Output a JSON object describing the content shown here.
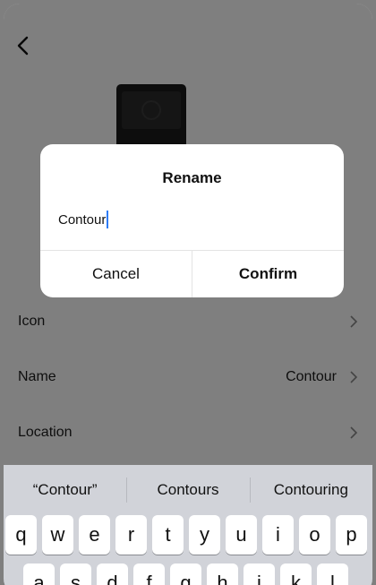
{
  "nav": {
    "back_icon": "chevron-left-icon"
  },
  "device": {
    "image": "doorbell-device-image"
  },
  "settings": {
    "rows": [
      {
        "label": "Icon",
        "value": ""
      },
      {
        "label": "Name",
        "value": "Contour"
      },
      {
        "label": "Location",
        "value": ""
      }
    ]
  },
  "dialog": {
    "title": "Rename",
    "input_value": "Contour",
    "cancel_label": "Cancel",
    "confirm_label": "Confirm"
  },
  "keyboard": {
    "suggestions": [
      "“Contour”",
      "Contours",
      "Contouring"
    ],
    "row1": [
      "q",
      "w",
      "e",
      "r",
      "t",
      "y",
      "u",
      "i",
      "o",
      "p"
    ],
    "row2": [
      "a",
      "s",
      "d",
      "f",
      "g",
      "h",
      "j",
      "k",
      "l"
    ]
  },
  "colors": {
    "caret": "#2e7cf6",
    "keyboard_bg": "#d1d3d9",
    "overlay": "rgba(0,0,0,0.5)"
  }
}
